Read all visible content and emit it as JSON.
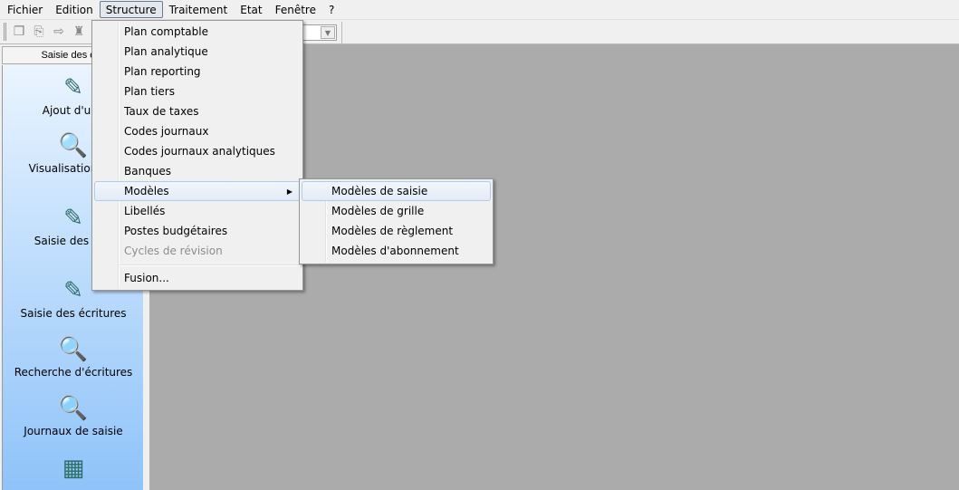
{
  "menubar": [
    "Fichier",
    "Edition",
    "Structure",
    "Traitement",
    "Etat",
    "Fenêtre",
    "?"
  ],
  "toolbar": {
    "icons": [
      "copy-icon",
      "paste-icon",
      "export-icon",
      "delete-icon"
    ]
  },
  "sidebar": {
    "header": "Saisie des écr",
    "items": [
      {
        "label": "Ajout d'une",
        "icon": "book-pencil-icon",
        "glyph": "✎"
      },
      {
        "label": "Visualisation/mo",
        "icon": "book-magnifier-icon",
        "glyph": "🔍"
      },
      {
        "label": "Saisie des opé",
        "icon": "book-pencil-icon",
        "glyph": "✎"
      },
      {
        "label": "Saisie des écritures",
        "icon": "book-pencil-icon",
        "glyph": "✎"
      },
      {
        "label": "Recherche d'écritures",
        "icon": "magnifier-icon",
        "glyph": "🔍"
      },
      {
        "label": "Journaux de saisie",
        "icon": "journal-magnifier-icon",
        "glyph": "🔍"
      },
      {
        "label": "",
        "icon": "calculator-icon",
        "glyph": "▦"
      }
    ]
  },
  "structure_menu": {
    "items": [
      {
        "label": "Plan comptable"
      },
      {
        "label": "Plan analytique"
      },
      {
        "label": "Plan reporting"
      },
      {
        "label": "Plan tiers"
      },
      {
        "label": "Taux de taxes"
      },
      {
        "label": "Codes journaux"
      },
      {
        "label": "Codes journaux analytiques"
      },
      {
        "label": "Banques"
      },
      {
        "label": "Modèles",
        "submenu": true,
        "highlighted": true
      },
      {
        "label": "Libellés"
      },
      {
        "label": "Postes budgétaires"
      },
      {
        "label": "Cycles de révision",
        "disabled": true
      }
    ],
    "after_separator": "Fusion..."
  },
  "models_submenu": {
    "items": [
      "Modèles de saisie",
      "Modèles de grille",
      "Modèles de règlement",
      "Modèles d'abonnement"
    ],
    "highlighted": "Modèles de saisie"
  }
}
